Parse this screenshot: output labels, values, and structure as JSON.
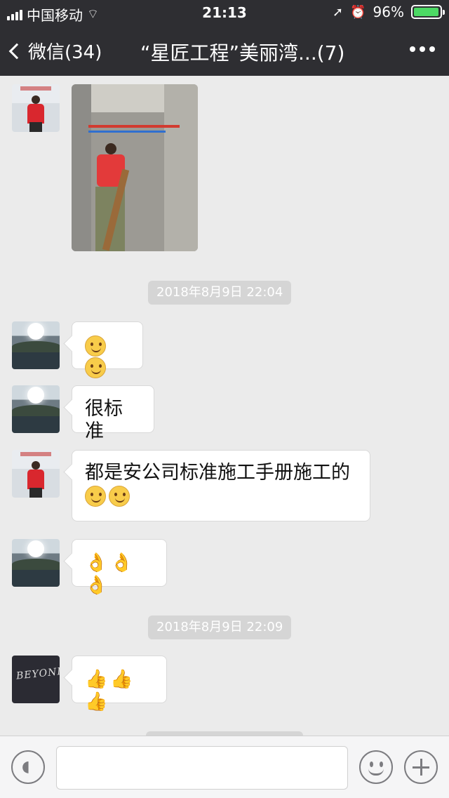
{
  "status": {
    "carrier": "中国移动",
    "time": "21:13",
    "battery": "96%",
    "battery_level": 0.96
  },
  "nav": {
    "back_label": "微信(34)",
    "title": "“星匠工程”美丽湾...(7)"
  },
  "messages": [
    {
      "type": "image"
    },
    {
      "type": "timestamp",
      "text": "2018年8月9日 22:04"
    },
    {
      "type": "text",
      "lines": [
        "🙂🙂"
      ]
    },
    {
      "type": "text",
      "lines": [
        "很标准"
      ]
    },
    {
      "type": "text",
      "lines": [
        "都是安公司标准施工手册施工的",
        "🙂🙂"
      ]
    },
    {
      "type": "text",
      "lines": [
        "👌👌👌"
      ]
    },
    {
      "type": "timestamp",
      "text": "2018年8月9日 22:09"
    },
    {
      "type": "text",
      "lines": [
        "👍👍👍"
      ]
    }
  ],
  "ts1": "2018年8月9日 22:04",
  "ts2": "2018年8月9日 22:09",
  "msg_text": {
    "m2": "很标准",
    "m3": "都是安公司标准施工手册施工的"
  },
  "emoji": {
    "ok": "👌",
    "thumbs": "👍"
  },
  "input": {
    "placeholder": ""
  },
  "avatars": {
    "book_text": "BEYOND"
  }
}
